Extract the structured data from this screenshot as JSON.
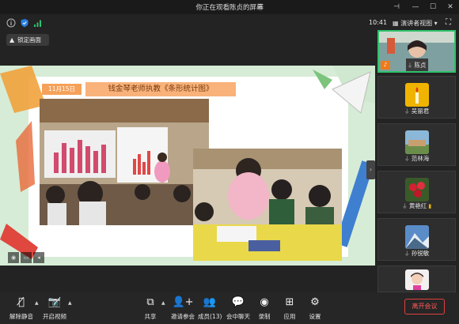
{
  "titlebar": {
    "title": "你正在观看陈贞的屏幕"
  },
  "status": {
    "time": "10:41",
    "view_mode": "演讲者视图"
  },
  "lock_button": {
    "label": "锁定画面"
  },
  "slide": {
    "date": "11月15日",
    "heading": "钱金琴老师执教《条形统计图》"
  },
  "participants": [
    {
      "name": "陈贞",
      "avatar": "teacher-video"
    },
    {
      "name": "吴丽君",
      "avatar": "candle-icon"
    },
    {
      "name": "范林海",
      "avatar": "landscape-icon"
    },
    {
      "name": "黄艳红",
      "avatar": "flower-icon"
    },
    {
      "name": "孙锐敏",
      "avatar": "mountain-icon"
    },
    {
      "name": "",
      "avatar": "child-photo"
    }
  ],
  "toolbar": {
    "mute": "解除静音",
    "video": "开启视频",
    "share": "共享",
    "invite": "邀请参会",
    "members": "成员(13)",
    "chat": "会中聊天",
    "record": "录制",
    "apps": "应用",
    "settings": "设置",
    "leave": "离开会议"
  },
  "colors": {
    "accent_green": "#2ec26b",
    "leave_red": "#e04040",
    "orange": "#f6a15a"
  }
}
